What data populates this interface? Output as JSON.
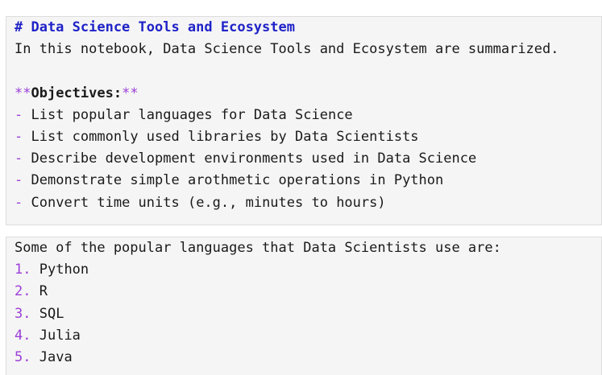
{
  "cell1": {
    "heading": "# Data Science Tools and Ecosystem",
    "intro": "In this notebook, Data Science Tools and Ecosystem are summarized.",
    "objectives_marker_open": "**",
    "objectives_label": "Objectives:",
    "objectives_marker_close": "**",
    "bullet_marker": "-",
    "objectives": [
      "List popular languages for Data Science",
      "List commonly used libraries by Data Scientists",
      "Describe development environments used in Data Science",
      "Demonstrate simple arothmetic operations in Python",
      "Convert time units (e.g., minutes to hours)"
    ]
  },
  "cell2": {
    "intro": "Some of the popular languages that Data Scientists use are:",
    "languages": [
      {
        "num": "1.",
        "name": "Python"
      },
      {
        "num": "2.",
        "name": "R"
      },
      {
        "num": "3.",
        "name": "SQL"
      },
      {
        "num": "4.",
        "name": "Julia"
      },
      {
        "num": "5.",
        "name": "Java"
      }
    ]
  }
}
